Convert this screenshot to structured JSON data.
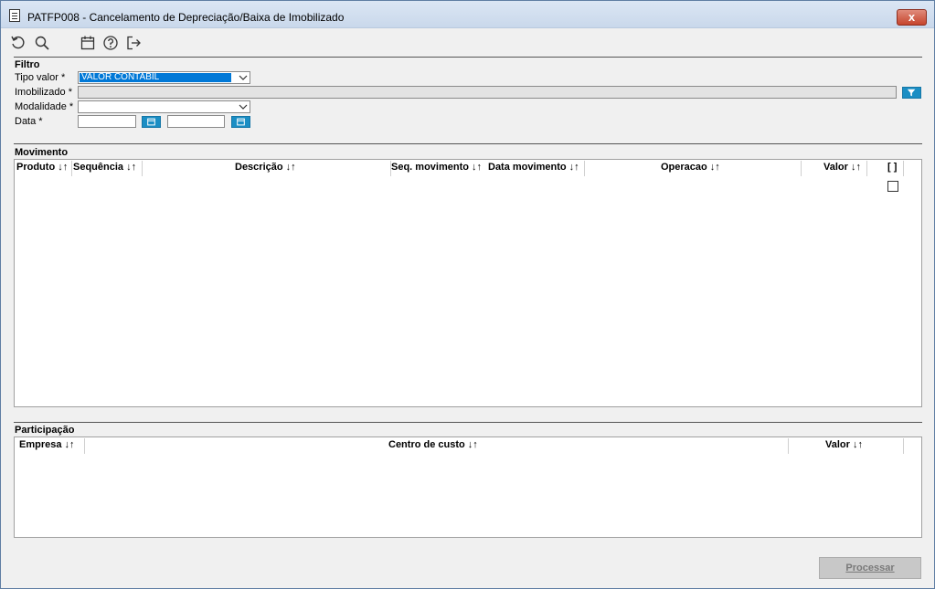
{
  "window": {
    "title": "PATFP008 - Cancelamento de Depreciação/Baixa de Imobilizado",
    "close_label": "x"
  },
  "toolbar": {
    "items": [
      "refresh-icon",
      "search-icon",
      "calendar-icon",
      "help-icon",
      "exit-icon"
    ]
  },
  "filtro": {
    "title": "Filtro",
    "tipo_valor": {
      "label": "Tipo valor *",
      "value": "VALOR CONTABIL"
    },
    "imobilizado": {
      "label": "Imobilizado *",
      "value": ""
    },
    "modalidade": {
      "label": "Modalidade *",
      "value": ""
    },
    "data": {
      "label": "Data *",
      "start": "",
      "end": ""
    }
  },
  "movimento": {
    "title": "Movimento",
    "columns": [
      "Produto ↓↑",
      "Sequência ↓↑",
      "Descrição ↓↑",
      "Seq. movimento ↓↑",
      "Data movimento ↓↑",
      "Operacao ↓↑",
      "Valor ↓↑",
      "[ ]"
    ]
  },
  "participacao": {
    "title": "Participação",
    "columns": [
      "Empresa ↓↑",
      "Centro de custo ↓↑",
      "Valor ↓↑"
    ]
  },
  "actions": {
    "process_label": "Processar"
  },
  "colors": {
    "accent": "#0078d7",
    "button_blue": "#1b8ec4"
  }
}
